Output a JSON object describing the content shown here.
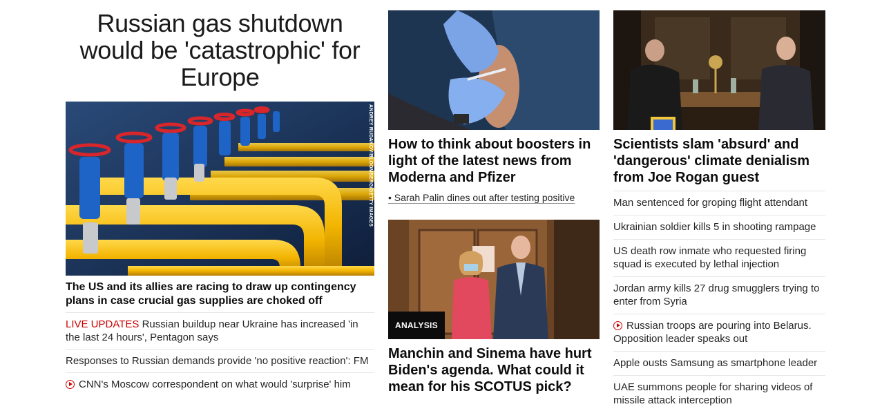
{
  "lead": {
    "headline": "Russian gas shutdown would be 'catastrophic' for Europe",
    "image_credit": "ANDREY RUDAKOV/BLOOMBERG/GETTY IMAGES",
    "subheadline": "The US and its allies are racing to draw up contingency plans in case crucial gas supplies are choked off",
    "related": [
      {
        "tag": "LIVE UPDATES",
        "text": "Russian buildup near Ukraine has increased 'in the last 24 hours', Pentagon says"
      },
      {
        "text": "Responses to Russian demands provide 'no positive reaction': FM"
      },
      {
        "icon": "play-icon",
        "text": "CNN's Moscow correspondent on what would 'surprise' him"
      }
    ]
  },
  "middle": {
    "story1": {
      "headline": "How to think about boosters in light of the latest news from Moderna and Pfizer",
      "bullet": "Sarah Palin dines out after testing positive"
    },
    "story2": {
      "label": "ANALYSIS",
      "headline": "Manchin and Sinema have hurt Biden's agenda. What could it mean for his SCOTUS pick?"
    }
  },
  "right": {
    "headline": "Scientists slam 'absurd' and 'dangerous' climate denialism from Joe Rogan guest",
    "items": [
      {
        "text": "Man sentenced for groping flight attendant"
      },
      {
        "text": "Ukrainian soldier kills 5 in shooting rampage"
      },
      {
        "text": "US death row inmate who requested firing squad is executed by lethal injection"
      },
      {
        "text": "Jordan army kills 27 drug smugglers trying to enter from Syria"
      },
      {
        "icon": "play-icon",
        "text": "Russian troops are pouring into Belarus. Opposition leader speaks out"
      },
      {
        "text": "Apple ousts Samsung as smartphone leader"
      },
      {
        "text": "UAE summons people for sharing videos of missile attack interception"
      }
    ]
  },
  "colors": {
    "live": "#cc0000",
    "text": "#0c0c0c"
  }
}
